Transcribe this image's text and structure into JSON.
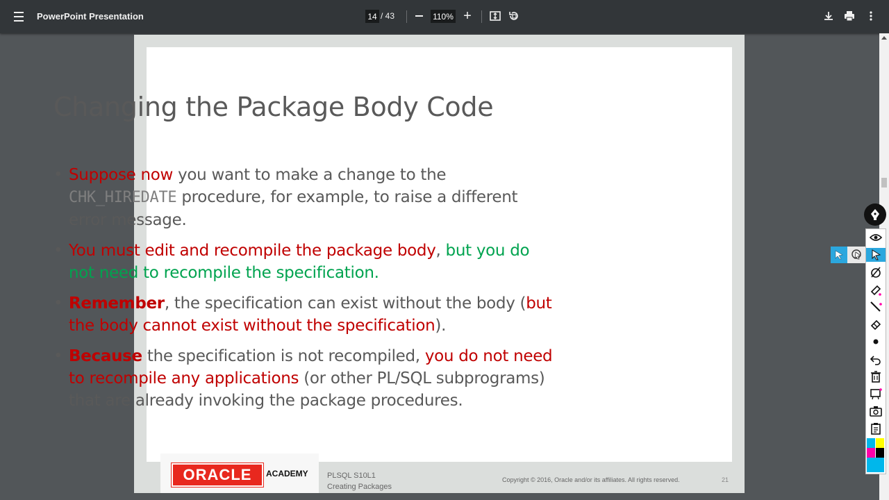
{
  "toolbar": {
    "title": "PowerPoint Presentation",
    "page_current": "14",
    "page_total": "/ 43",
    "zoom": "110%",
    "plus": "+"
  },
  "slide": {
    "title": "Changing the Package Body Code",
    "bullets": [
      {
        "parts": [
          {
            "text": "Suppose now",
            "style": "red"
          },
          {
            "text": " you want to make a change to the ",
            "style": "normal"
          },
          {
            "text": "CHK_HIREDATE",
            "style": "mono"
          },
          {
            "text": " procedure, for example, to raise a different error message.",
            "style": "normal"
          }
        ]
      },
      {
        "parts": [
          {
            "text": "You must edit and recompile the package body",
            "style": "red"
          },
          {
            "text": ", ",
            "style": "normal"
          },
          {
            "text": "but you do not need to recompile the specification.",
            "style": "green"
          }
        ]
      },
      {
        "parts": [
          {
            "text": "Remember",
            "style": "red-bold"
          },
          {
            "text": ", the specification can exist without the body (",
            "style": "normal"
          },
          {
            "text": "but the body cannot exist without the specification",
            "style": "red"
          },
          {
            "text": ").",
            "style": "normal"
          }
        ]
      },
      {
        "parts": [
          {
            "text": "Because",
            "style": "red-bold"
          },
          {
            "text": " the specification is not recompiled, ",
            "style": "normal"
          },
          {
            "text": "you do not need to recompile any applications",
            "style": "red"
          },
          {
            "text": " (or other PL/SQL subprograms) that are already invoking the package procedures.",
            "style": "normal"
          }
        ]
      }
    ],
    "bullet_char": "•",
    "footer": {
      "logo_text": "ORACLE",
      "academy": "ACADEMY",
      "course_line1": "PLSQL S10L1",
      "course_line2": "Creating Packages",
      "copyright": "Copyright © 2016, Oracle and/or its affiliates. All rights reserved.",
      "page_number": "21"
    }
  },
  "tools": [
    "pen-icon",
    "eye-icon",
    "pointer-icon",
    "eraser-off-icon",
    "highlighter-icon",
    "line-icon",
    "eraser-icon",
    "dot-icon",
    "undo-icon",
    "trash-icon",
    "whiteboard-icon",
    "camera-icon",
    "clipboard-icon"
  ],
  "colors": {
    "accent": "#2ba7de",
    "red": "#c00000",
    "green": "#00a34f",
    "swatches": [
      "#00b7eb",
      "#ffff00",
      "#ff00a8",
      "#000000",
      "#00b7eb"
    ]
  }
}
